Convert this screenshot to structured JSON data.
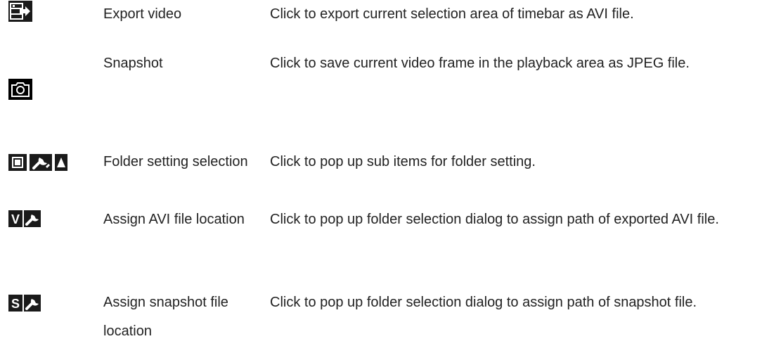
{
  "rows": [
    {
      "icon": "export-video-icon",
      "name": "Export video",
      "description": "Click to export current selection area of timebar as AVI file."
    },
    {
      "icon": "camera-icon",
      "name": "Snapshot",
      "description": "Click to save current video frame in the playback area as JPEG file."
    },
    {
      "icon": "folder-setting-icon",
      "name": "Folder setting selection",
      "description": "Click to pop up sub items for folder setting."
    },
    {
      "icon": "avi-folder-icon",
      "icon_letter": "V",
      "name": "Assign AVI file location",
      "description": "Click to pop up folder selection dialog to assign path of exported AVI file."
    },
    {
      "icon": "snapshot-folder-icon",
      "icon_letter": "S",
      "name": "Assign snapshot file location",
      "description": "Click to pop up folder selection dialog to assign path of snapshot file."
    }
  ],
  "colors": {
    "icon_dark": "#1a1a1a",
    "icon_light": "#ffffff",
    "text": "#222222"
  }
}
